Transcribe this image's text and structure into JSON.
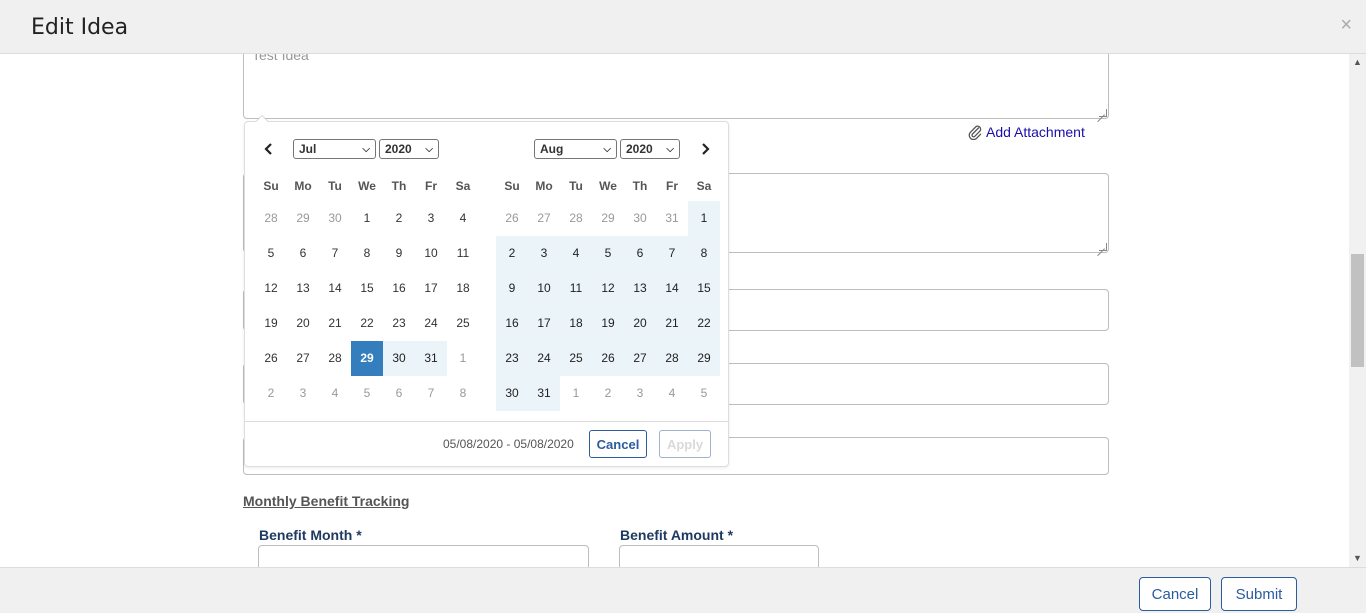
{
  "modal": {
    "title": "Edit Idea",
    "close_symbol": "×"
  },
  "form": {
    "description_value": "Test Idea",
    "add_attachment_label": "Add Attachment",
    "section_title": "Monthly Benefit Tracking",
    "benefit_month_label": "Benefit Month",
    "benefit_amount_label": "Benefit Amount",
    "required_marker": "*"
  },
  "datepicker": {
    "left": {
      "month": "Jul",
      "year": "2020",
      "weekdays": [
        "Su",
        "Mo",
        "Tu",
        "We",
        "Th",
        "Fr",
        "Sa"
      ],
      "weeks": [
        [
          "28",
          "29",
          "30",
          "1",
          "2",
          "3",
          "4"
        ],
        [
          "5",
          "6",
          "7",
          "8",
          "9",
          "10",
          "11"
        ],
        [
          "12",
          "13",
          "14",
          "15",
          "16",
          "17",
          "18"
        ],
        [
          "19",
          "20",
          "21",
          "22",
          "23",
          "24",
          "25"
        ],
        [
          "26",
          "27",
          "28",
          "29",
          "30",
          "31",
          "1"
        ],
        [
          "2",
          "3",
          "4",
          "5",
          "6",
          "7",
          "8"
        ]
      ]
    },
    "right": {
      "month": "Aug",
      "year": "2020",
      "weekdays": [
        "Su",
        "Mo",
        "Tu",
        "We",
        "Th",
        "Fr",
        "Sa"
      ],
      "weeks": [
        [
          "26",
          "27",
          "28",
          "29",
          "30",
          "31",
          "1"
        ],
        [
          "2",
          "3",
          "4",
          "5",
          "6",
          "7",
          "8"
        ],
        [
          "9",
          "10",
          "11",
          "12",
          "13",
          "14",
          "15"
        ],
        [
          "16",
          "17",
          "18",
          "19",
          "20",
          "21",
          "22"
        ],
        [
          "23",
          "24",
          "25",
          "26",
          "27",
          "28",
          "29"
        ],
        [
          "30",
          "31",
          "1",
          "2",
          "3",
          "4",
          "5"
        ]
      ]
    },
    "range_text": "05/08/2020 - 05/08/2020",
    "cancel_label": "Cancel",
    "apply_label": "Apply",
    "prev_icon": "chevron-left-icon",
    "next_icon": "chevron-right-icon"
  },
  "footer": {
    "cancel_label": "Cancel",
    "submit_label": "Submit"
  },
  "colors": {
    "accent": "#2b5c9e",
    "selected_day": "#357ebd",
    "in_range": "#ebf4f8"
  }
}
